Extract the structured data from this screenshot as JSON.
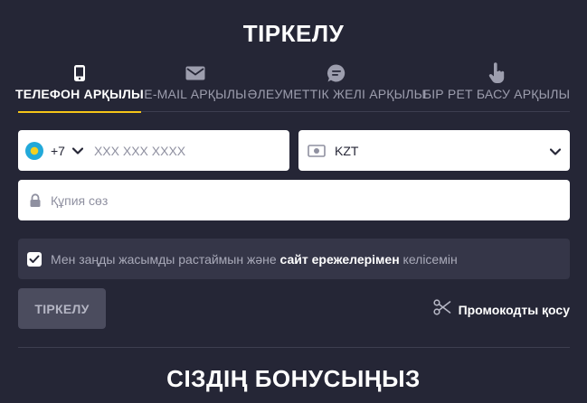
{
  "title": "ТІРКЕЛУ",
  "tabs": [
    {
      "label": "ТЕЛЕФОН АРҚЫЛЫ",
      "icon": "phone-icon",
      "active": true
    },
    {
      "label": "E-MAIL АРҚЫЛЫ",
      "icon": "mail-icon",
      "active": false
    },
    {
      "label": "ӘЛЕУМЕТТІК ЖЕЛІ АРҚЫЛЫ",
      "icon": "chat-icon",
      "active": false
    },
    {
      "label": "БІР РЕТ БАСУ АРҚЫЛЫ",
      "icon": "tap-icon",
      "active": false
    }
  ],
  "phone": {
    "country_code": "+7",
    "placeholder": "XXX XXX XXXX",
    "flag": "kz-flag-icon"
  },
  "currency": {
    "value": "KZT",
    "icon": "banknote-icon"
  },
  "password": {
    "placeholder": "Құпия сөз",
    "icon": "lock-icon"
  },
  "agreement": {
    "checked": true,
    "text_before": "Мен заңды жасымды растаймын және ",
    "link": "сайт ережелерімен",
    "text_after": " келісемін"
  },
  "submit_label": "ТІРКЕЛУ",
  "promo": {
    "label": "Промокодты қосу",
    "icon": "scissors-icon"
  },
  "bonus_title": "СІЗДІҢ БОНУСЫҢЫЗ",
  "colors": {
    "background": "#252636",
    "accent": "#f5c518",
    "panel": "#353648",
    "button": "#4b4c5e"
  }
}
